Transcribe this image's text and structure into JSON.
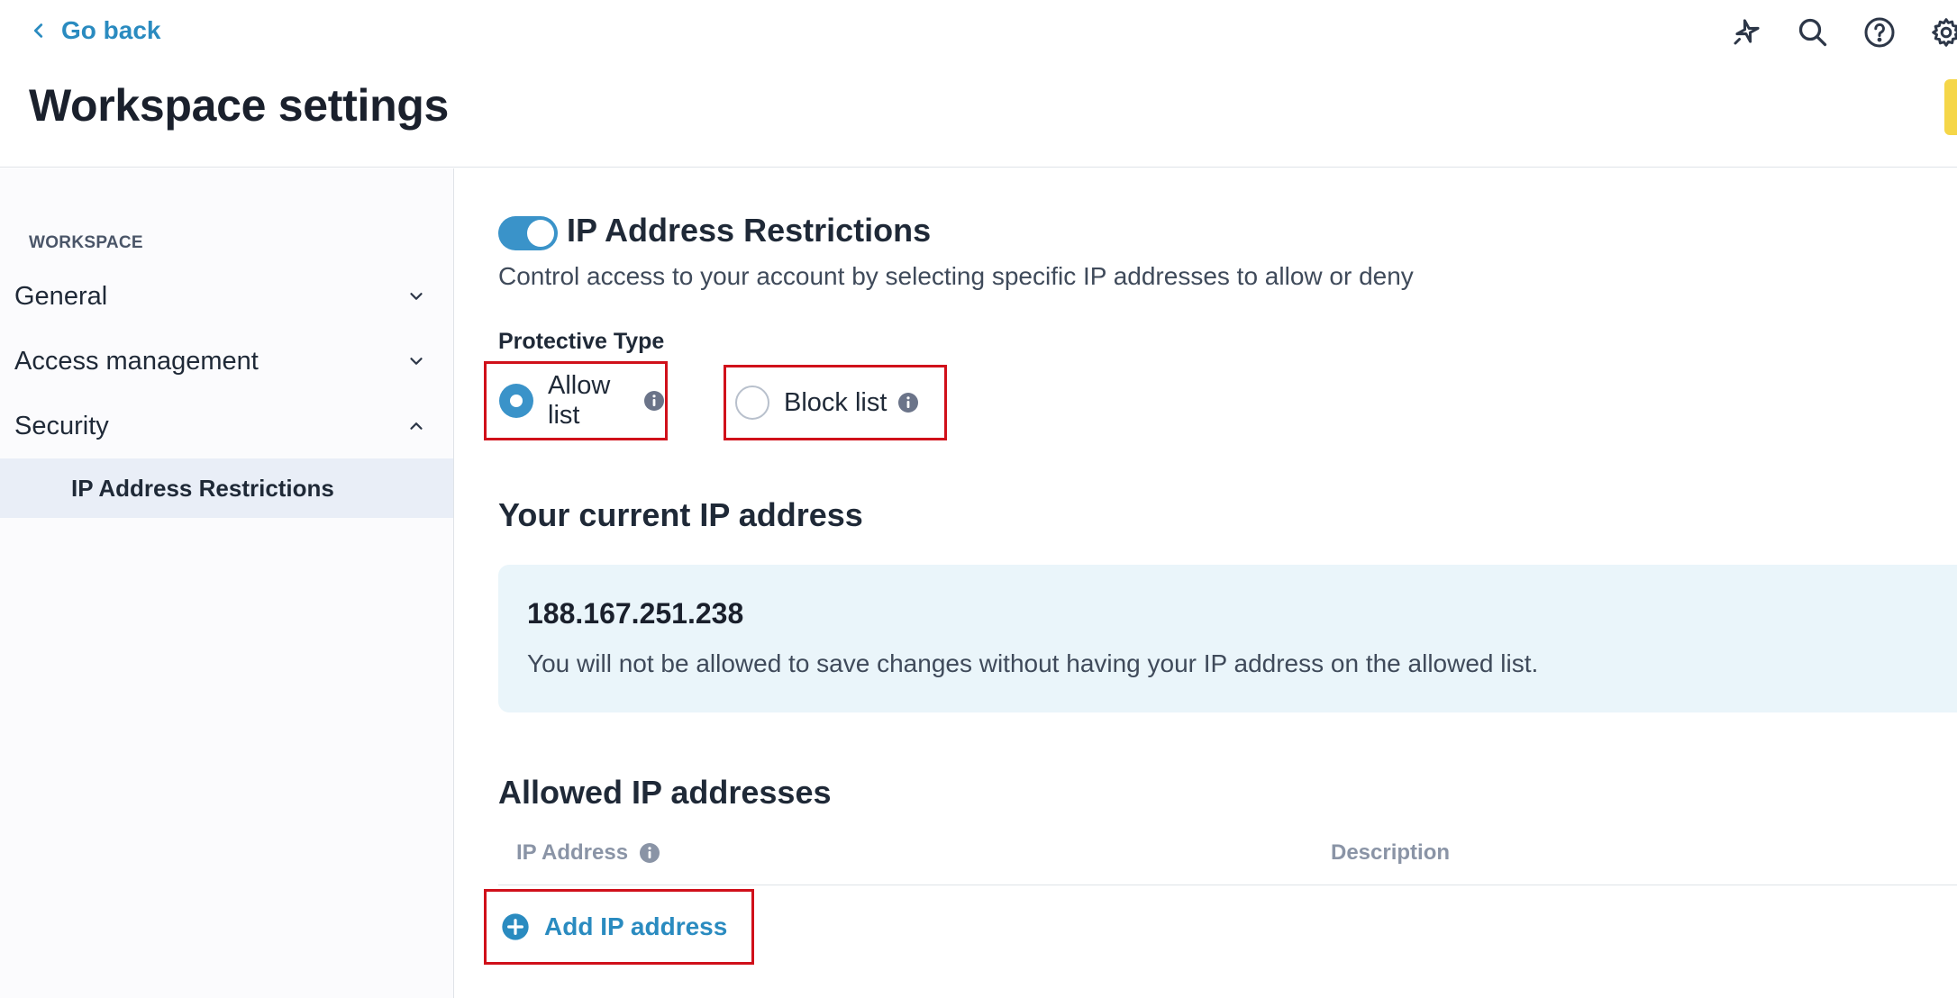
{
  "header": {
    "go_back": "Go back",
    "title": "Workspace settings",
    "icons": [
      "sparkle-icon",
      "search-icon",
      "help-icon",
      "gear-icon"
    ]
  },
  "sidebar": {
    "section": "WORKSPACE",
    "items": [
      {
        "label": "General",
        "state": "collapsed"
      },
      {
        "label": "Access management",
        "state": "collapsed"
      },
      {
        "label": "Security",
        "state": "expanded"
      }
    ],
    "sub_item": "IP Address Restrictions"
  },
  "main": {
    "toggle_on": true,
    "title": "IP Address Restrictions",
    "description": "Control access to your account by selecting specific IP addresses to allow or deny",
    "protective_type_label": "Protective Type",
    "options": [
      {
        "label": "Allow list",
        "selected": true
      },
      {
        "label": "Block list",
        "selected": false
      }
    ],
    "current_ip_heading": "Your current IP address",
    "current_ip": "188.167.251.238",
    "current_ip_note": "You will not be allowed to save changes without having your IP address on the allowed list.",
    "allowed_heading": "Allowed IP addresses",
    "columns": [
      "IP Address",
      "Description"
    ],
    "add_button": "Add IP address"
  },
  "colors": {
    "accent": "#2a8bc0",
    "toggle": "#3a93c9",
    "highlight": "#d0101a",
    "card_bg": "#eaf5fa",
    "sidebar_active": "#e9eef7"
  }
}
